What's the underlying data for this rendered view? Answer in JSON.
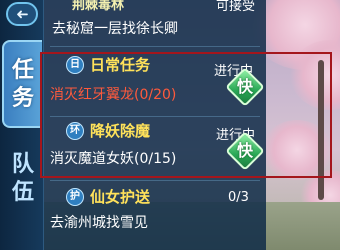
{
  "tabs": [
    {
      "chars": [
        "任",
        "务"
      ],
      "icon": "arrow-left-icon"
    },
    {
      "chars": [
        "队",
        "伍"
      ]
    }
  ],
  "quests": [
    {
      "badge": "",
      "name": "荆棘毒林",
      "status": "可接受",
      "desc": "去秘窟一层找徐长卿"
    },
    {
      "badge": "日",
      "name": "日常任务",
      "status": "进行中",
      "desc": "消灭红牙翼龙(0/20)",
      "action": "快"
    },
    {
      "badge": "环",
      "name": "降妖除魔",
      "status": "进行中",
      "desc": "消灭魔道女妖(0/15)",
      "action": "快"
    },
    {
      "badge": "护",
      "name": "仙女护送",
      "status": "0/3",
      "desc": "去渝州城找雪见"
    }
  ],
  "colors": {
    "highlight": "#a4161c",
    "quest_name": "#ffe25a",
    "desc_alert": "#ff5a3c"
  }
}
